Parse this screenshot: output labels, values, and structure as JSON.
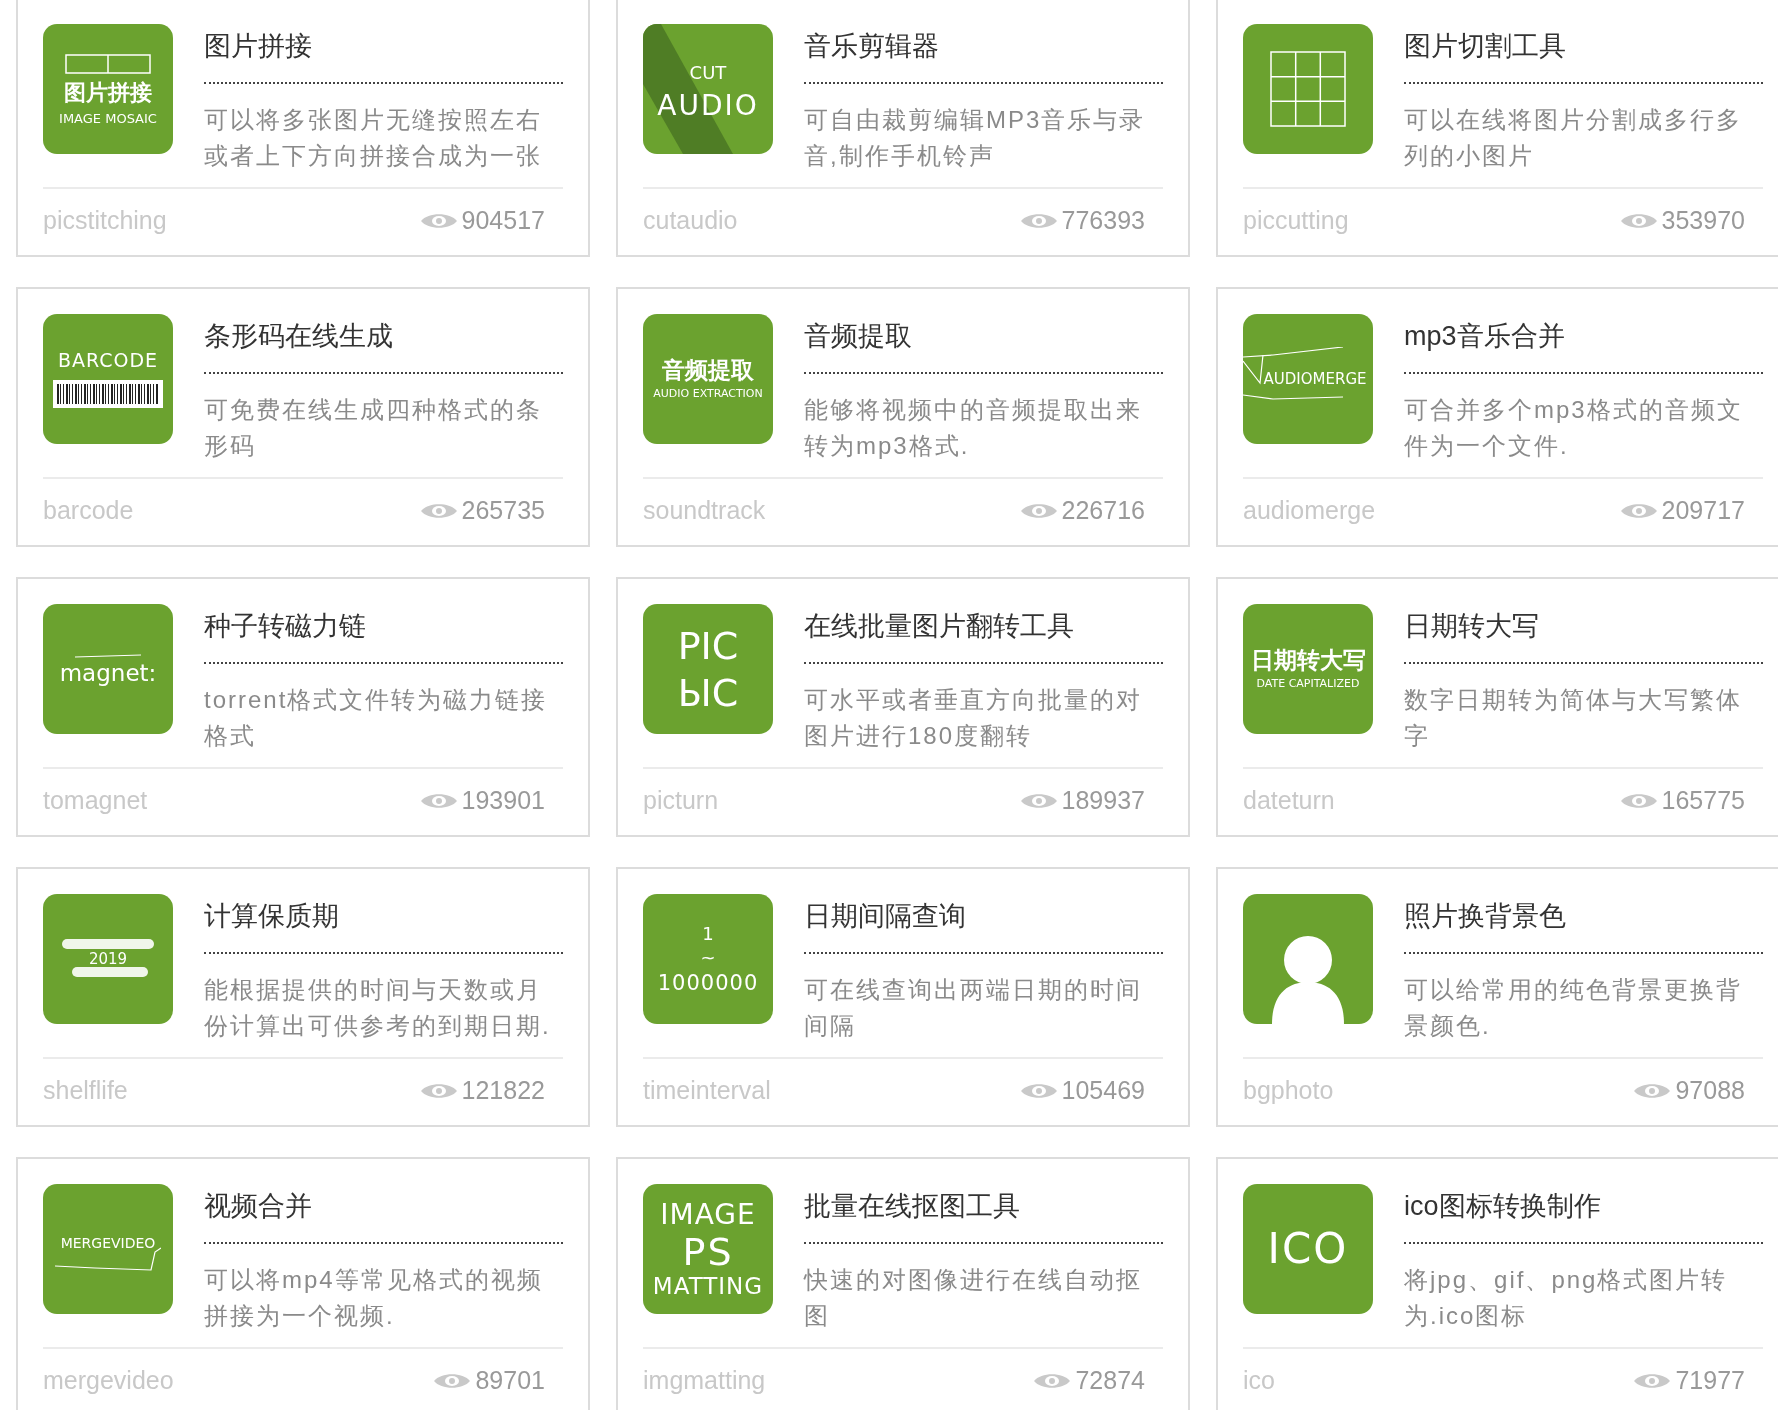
{
  "tools": [
    {
      "title": "图片拼接",
      "description": "可以将多张图片无缝按照左右或者上下方向拼接合成为一张",
      "slug": "picstitching",
      "views": "904517",
      "logo": {
        "kind": "mosaic",
        "lines": [
          "图片拼接",
          "IMAGE MOSAIC"
        ]
      }
    },
    {
      "title": "音乐剪辑器",
      "description": "可自由裁剪编辑MP3音乐与录音,制作手机铃声",
      "slug": "cutaudio",
      "views": "776393",
      "logo": {
        "kind": "cutaudio",
        "lines": [
          "CUT",
          "AUDIO"
        ]
      }
    },
    {
      "title": "图片切割工具",
      "description": "可以在线将图片分割成多行多列的小图片",
      "slug": "piccutting",
      "views": "353970",
      "logo": {
        "kind": "grid"
      }
    },
    {
      "title": "条形码在线生成",
      "description": "可免费在线生成四种格式的条形码",
      "slug": "barcode",
      "views": "265735",
      "logo": {
        "kind": "barcode",
        "lines": [
          "BARCODE"
        ]
      }
    },
    {
      "title": "音频提取",
      "description": "能够将视频中的音频提取出来转为mp3格式.",
      "slug": "soundtrack",
      "views": "226716",
      "logo": {
        "kind": "caption",
        "lines": [
          "音频提取",
          "AUDIO EXTRACTION"
        ]
      }
    },
    {
      "title": "mp3音乐合并",
      "description": "可合并多个mp3格式的音频文件为一个文件.",
      "slug": "audiomerge",
      "views": "209717",
      "logo": {
        "kind": "audiomerge",
        "lines": [
          "AUDIOMERGE"
        ]
      }
    },
    {
      "title": "种子转磁力链",
      "description": "torrent格式文件转为磁力链接格式",
      "slug": "tomagnet",
      "views": "193901",
      "logo": {
        "kind": "magnet",
        "lines": [
          "magnet:"
        ]
      }
    },
    {
      "title": "在线批量图片翻转工具",
      "description": "可水平或者垂直方向批量的对图片进行180度翻转",
      "slug": "picturn",
      "views": "189937",
      "logo": {
        "kind": "flip",
        "lines": [
          "PIC",
          "PIC"
        ]
      }
    },
    {
      "title": "日期转大写",
      "description": "数字日期转为简体与大写繁体字",
      "slug": "dateturn",
      "views": "165775",
      "logo": {
        "kind": "caption",
        "lines": [
          "日期转大写",
          "DATE CAPITALIZED"
        ]
      }
    },
    {
      "title": "计算保质期",
      "description": "能根据提供的时间与天数或月份计算出可供参考的到期日期.",
      "slug": "shelflife",
      "views": "121822",
      "logo": {
        "kind": "blurred",
        "lines": [
          "2019"
        ]
      }
    },
    {
      "title": "日期间隔查询",
      "description": "可在线查询出两端日期的时间间隔",
      "slug": "timeinterval",
      "views": "105469",
      "logo": {
        "kind": "stack",
        "lines": [
          "1",
          "~",
          "1000000"
        ]
      }
    },
    {
      "title": "照片换背景色",
      "description": "可以给常用的纯色背景更换背景颜色.",
      "slug": "bgphoto",
      "views": "97088",
      "logo": {
        "kind": "person"
      }
    },
    {
      "title": "视频合并",
      "description": "可以将mp4等常见格式的视频拼接为一个视频.",
      "slug": "mergevideo",
      "views": "89701",
      "logo": {
        "kind": "mergevideo",
        "lines": [
          "MERGEVIDEO"
        ]
      }
    },
    {
      "title": "批量在线抠图工具",
      "description": "快速的对图像进行在线自动抠图",
      "slug": "imgmatting",
      "views": "72874",
      "logo": {
        "kind": "matting",
        "lines": [
          "IMAGE",
          "PS",
          "MATTING"
        ]
      }
    },
    {
      "title": "ico图标转换制作",
      "description": "将jpg、gif、png格式图片转为.ico图标",
      "slug": "ico",
      "views": "71977",
      "logo": {
        "kind": "big",
        "lines": [
          "ICO"
        ]
      }
    }
  ]
}
